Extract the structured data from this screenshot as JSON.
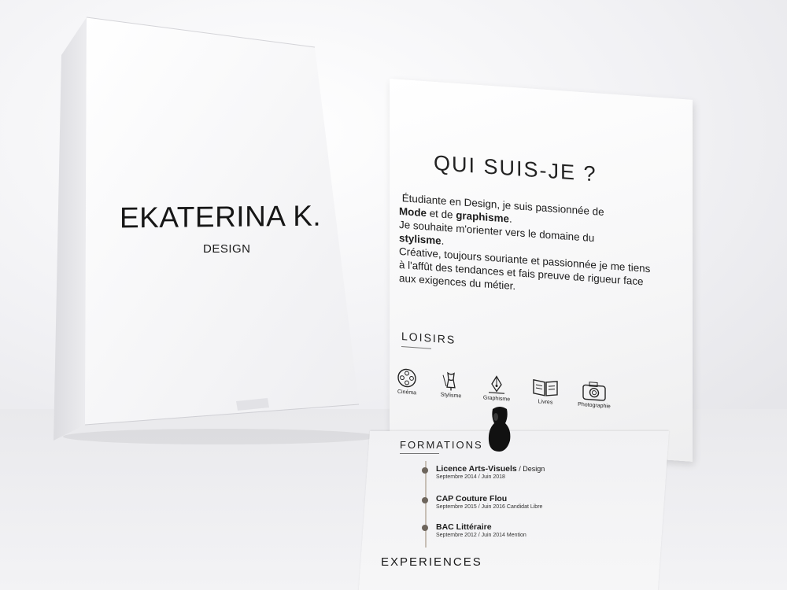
{
  "box": {
    "name": "EKATERINA K.",
    "subtitle": "DESIGN"
  },
  "card": {
    "heading": "QUI SUIS-JE ?",
    "intro": {
      "line1_before": "Étudiante en Design, je suis passionnée de",
      "mode": "Mode",
      "and": "et de",
      "graphisme": "graphisme",
      "orient": "Je souhaite m'orienter vers le domaine du",
      "stylisme": "stylisme",
      "rest": "Créative, toujours souriante et passionnée je me tiens à l'affût des tendances et fais preuve de rigueur face aux exigences du métier."
    },
    "loisirs_title": "LOISIRS",
    "hobbies": [
      {
        "label": "Cinéma",
        "icon": "film-reel-icon"
      },
      {
        "label": "Stylisme",
        "icon": "mannequin-icon"
      },
      {
        "label": "Graphisme",
        "icon": "pen-nib-icon"
      },
      {
        "label": "Livres",
        "icon": "open-book-icon"
      },
      {
        "label": "Photographie",
        "icon": "camera-icon"
      }
    ],
    "formations_title": "FORMATIONS",
    "formations": [
      {
        "title": "Licence Arts-Visuels",
        "suffix": " / Design",
        "dates": "Septembre 2014 / Juin 2018"
      },
      {
        "title": "CAP Couture Flou",
        "suffix": "",
        "dates": "Septembre 2015 / Juin 2016  Candidat Libre"
      },
      {
        "title": "BAC Littéraire",
        "suffix": "",
        "dates": "Septembre 2012 / Juin 2014  Mention"
      }
    ],
    "experiences_title": "EXPERIENCES"
  }
}
